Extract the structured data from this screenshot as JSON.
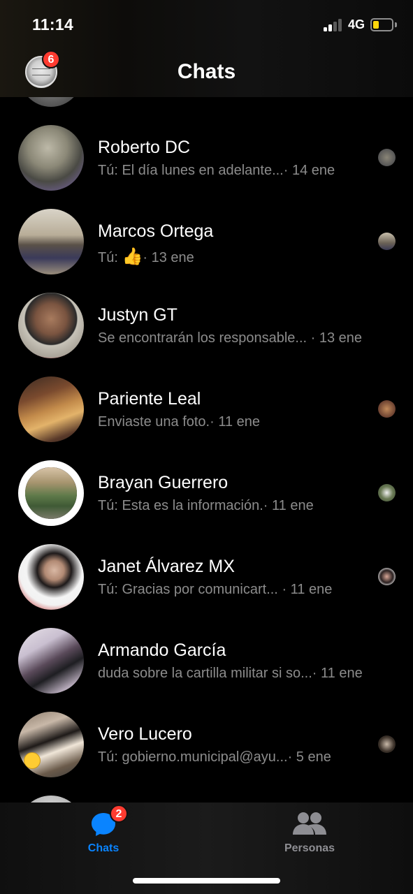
{
  "status_bar": {
    "time": "11:14",
    "network": "4G",
    "battery_level": 0.25,
    "battery_color": "#ffd60a"
  },
  "header": {
    "title": "Chats",
    "profile_badge": "6"
  },
  "chats": [
    {
      "name": "Roberto DC",
      "preview": "Tú: El día lunes en adelante...",
      "date": "· 14 ene",
      "avatar": "avatar-roberto"
    },
    {
      "name": "Marcos Ortega",
      "preview": "Tú:",
      "emoji": "👍",
      "date": "· 13 ene",
      "avatar": "avatar-marcos"
    },
    {
      "name": "Justyn GT",
      "preview": "Se encontrarán los responsable...",
      "date": "· 13 ene",
      "avatar": "avatar-justyn"
    },
    {
      "name": "Pariente Leal",
      "preview": "Enviaste una foto.",
      "date": "· 11 ene",
      "avatar": "avatar-pariente"
    },
    {
      "name": "Brayan Guerrero",
      "preview": "Tú: Esta es la información.",
      "date": "· 11 ene",
      "avatar": "avatar-brayan"
    },
    {
      "name": "Janet Álvarez MX",
      "preview": "Tú: Gracias por comunicart...",
      "date": "· 11 ene",
      "avatar": "avatar-janet"
    },
    {
      "name": "Armando García",
      "preview": "duda sobre la cartilla militar si so...",
      "date": "· 11 ene",
      "avatar": "avatar-armando"
    },
    {
      "name": "Vero Lucero",
      "preview": "Tú: gobierno.municipal@ayu...",
      "date": "· 5 ene",
      "avatar": "avatar-vero"
    }
  ],
  "tab_bar": {
    "chats_label": "Chats",
    "chats_badge": "2",
    "people_label": "Personas",
    "active_color": "#0a84ff",
    "inactive_color": "#8e8e93"
  }
}
